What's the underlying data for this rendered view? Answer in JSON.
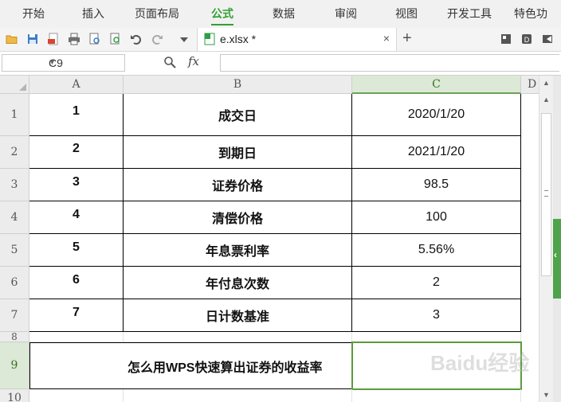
{
  "menu": {
    "items": [
      {
        "label": "开始",
        "active": false
      },
      {
        "label": "插入",
        "active": false
      },
      {
        "label": "页面布局",
        "active": false
      },
      {
        "label": "公式",
        "active": true
      },
      {
        "label": "数据",
        "active": false
      },
      {
        "label": "审阅",
        "active": false
      },
      {
        "label": "视图",
        "active": false
      },
      {
        "label": "开发工具",
        "active": false
      },
      {
        "label": "特色功",
        "active": false
      }
    ]
  },
  "tab": {
    "title": "e.xlsx *",
    "close": "×",
    "new": "+"
  },
  "formula_bar": {
    "cell_ref": "C9",
    "fx": "fx",
    "value": ""
  },
  "columns": [
    "A",
    "B",
    "C",
    "D"
  ],
  "rows": [
    "1",
    "2",
    "3",
    "4",
    "5",
    "6",
    "7",
    "8",
    "9",
    "10"
  ],
  "table": [
    {
      "n": "1",
      "label": "成交日",
      "value": "2020/1/20"
    },
    {
      "n": "2",
      "label": "到期日",
      "value": "2021/1/20"
    },
    {
      "n": "3",
      "label": "证券价格",
      "value": "98.5"
    },
    {
      "n": "4",
      "label": "清偿价格",
      "value": "100"
    },
    {
      "n": "5",
      "label": "年息票利率",
      "value": "5.56%"
    },
    {
      "n": "6",
      "label": "年付息次数",
      "value": "2"
    },
    {
      "n": "7",
      "label": "日计数基准",
      "value": "3"
    }
  ],
  "row9_text": "怎么用WPS快速算出证券的收益率",
  "watermark": "Baidu经验",
  "accent": "#33a133"
}
